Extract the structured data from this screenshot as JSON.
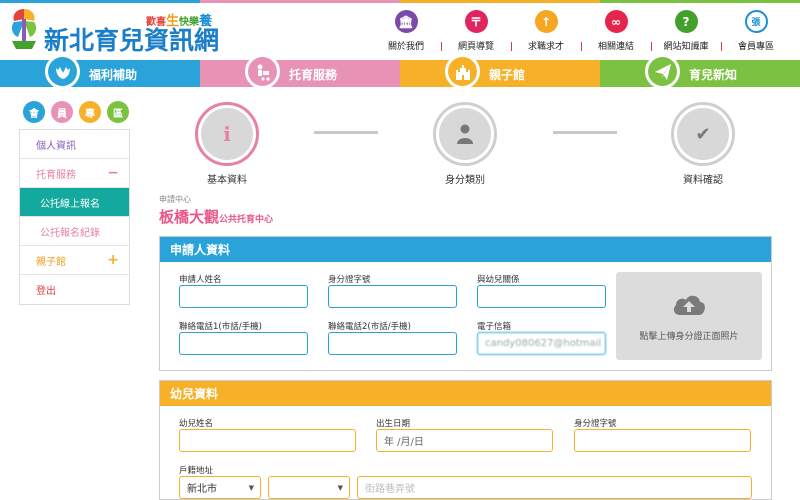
{
  "header": {
    "logo_text": "新北育兒資訊網",
    "slogan": [
      "歡喜",
      "生",
      "快樂",
      "養"
    ],
    "top_nav": [
      {
        "label": "關於我們",
        "icon": "building-icon",
        "glyph": "🏛",
        "color": "#7b4aa8"
      },
      {
        "label": "網頁導覽",
        "icon": "sitemap-icon",
        "glyph": "〒",
        "color": "#e0245e"
      },
      {
        "label": "求職求才",
        "icon": "up-arrow-icon",
        "glyph": "↑",
        "color": "#f5a623"
      },
      {
        "label": "相關連結",
        "icon": "link-icon",
        "glyph": "∞",
        "color": "#e6244c"
      },
      {
        "label": "網站知識庫",
        "icon": "question-icon",
        "glyph": "?",
        "color": "#43a02b"
      },
      {
        "label": "會員專區",
        "icon": "member-icon",
        "glyph": "張",
        "color": "#1a8fd6"
      }
    ]
  },
  "main_nav": [
    {
      "label": "福利補助",
      "icon": "hands-icon",
      "color": "#29a3d9"
    },
    {
      "label": "托育服務",
      "icon": "stroller-icon",
      "color": "#e893b5"
    },
    {
      "label": "親子館",
      "icon": "castle-icon",
      "color": "#f6b129"
    },
    {
      "label": "育兒新知",
      "icon": "paper-plane-icon",
      "color": "#7cc242"
    }
  ],
  "member_badge": [
    {
      "char": "會",
      "color": "#29a3d9"
    },
    {
      "char": "員",
      "color": "#e893b5"
    },
    {
      "char": "專",
      "color": "#f6b129"
    },
    {
      "char": "區",
      "color": "#7cc242"
    }
  ],
  "sidebar": [
    {
      "label": "個人資訊",
      "color": "#8a5cb8",
      "bg": "#ffffff",
      "suffix": ""
    },
    {
      "label": "托育服務",
      "color": "#e8819f",
      "bg": "#ffffff",
      "suffix": "−"
    },
    {
      "label": "公托線上報名",
      "color": "#ffffff",
      "bg": "#14a99f",
      "suffix": ""
    },
    {
      "label": "公托報名紀錄",
      "color": "#e8819f",
      "bg": "#ffffff",
      "suffix": ""
    },
    {
      "label": "親子館",
      "color": "#f29d1b",
      "bg": "#ffffff",
      "suffix": "+"
    },
    {
      "label": "登出",
      "color": "#e2453c",
      "bg": "#ffffff",
      "suffix": ""
    }
  ],
  "steps": [
    {
      "label": "基本資料",
      "glyph": "i"
    },
    {
      "label": "身分類別",
      "glyph": ""
    },
    {
      "label": "資料確認",
      "glyph": "✔"
    }
  ],
  "center": {
    "small_label": "申請中心",
    "name": "板橋大觀",
    "suffix": "公共托育中心"
  },
  "applicant": {
    "title": "申請人資料",
    "fields": [
      {
        "label": "申請人姓名",
        "value": ""
      },
      {
        "label": "身分證字號",
        "value": ""
      },
      {
        "label": "與幼兒關係",
        "value": ""
      },
      {
        "label": "聯絡電話1(市話/手機)",
        "value": ""
      },
      {
        "label": "聯絡電話2(市話/手機)",
        "value": ""
      },
      {
        "label": "電子信箱",
        "value": "candy080627@hotmail"
      }
    ],
    "upload_label": "點擊上傳身分證正面照片"
  },
  "child": {
    "title": "幼兒資料",
    "fields": [
      {
        "label": "幼兒姓名",
        "value": ""
      },
      {
        "label": "出生日期",
        "value": "年 /月/日"
      },
      {
        "label": "身分證字號",
        "value": ""
      }
    ],
    "address_label": "戶籍地址",
    "city": "新北市",
    "district": "",
    "road_placeholder": "街路巷弄號"
  }
}
